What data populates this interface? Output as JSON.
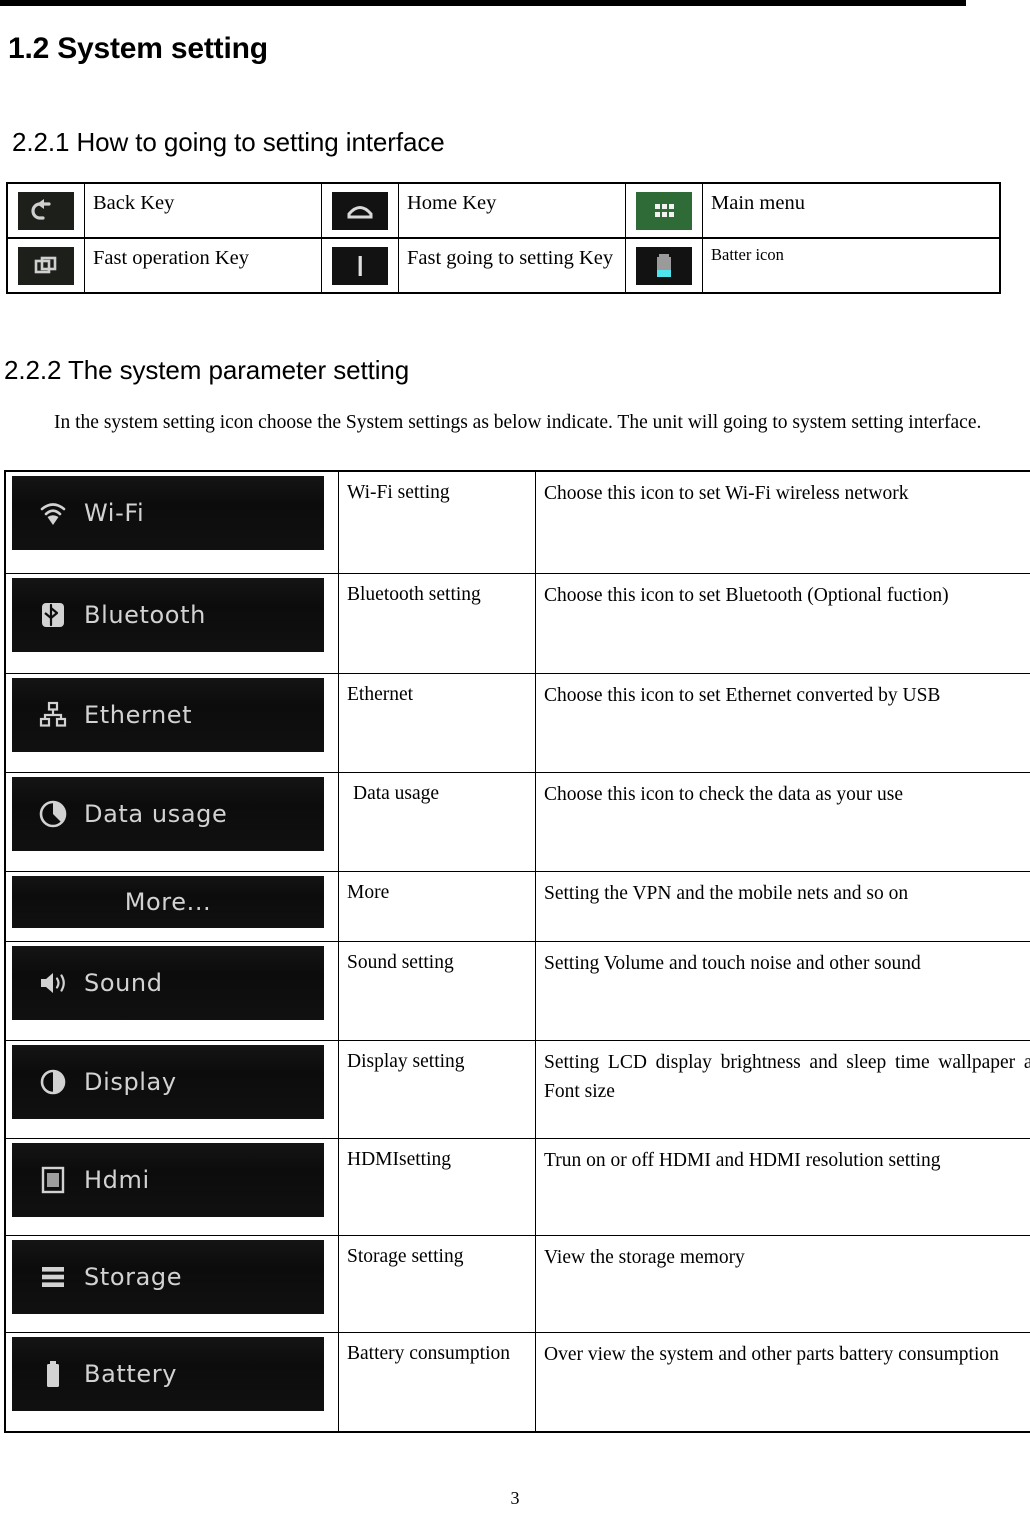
{
  "document": {
    "chapter_heading": "1.2 System setting",
    "section_221_heading": "2.2.1 How to going to setting interface",
    "section_222_heading": "2.2.2 The system parameter setting",
    "intro_paragraph": "In the system setting icon choose the System settings as below indicate. The unit will going to system setting interface.",
    "page_number": "3"
  },
  "nav_table": {
    "rows": [
      {
        "cells": [
          {
            "icon": "back-key-icon",
            "label": "Back Key"
          },
          {
            "icon": "home-key-icon",
            "label": "Home Key"
          },
          {
            "icon": "main-menu-icon",
            "label": "Main menu"
          }
        ]
      },
      {
        "cells": [
          {
            "icon": "fast-operation-key-icon",
            "label": "Fast operation Key"
          },
          {
            "icon": "fast-setting-key-icon",
            "label": "Fast going to setting Key"
          },
          {
            "icon": "battery-icon",
            "label": "Batter icon"
          }
        ]
      }
    ]
  },
  "settings_table": {
    "rows": [
      {
        "image_label": "Wi-Fi",
        "image_icon": "wifi-icon",
        "name": "Wi-Fi setting",
        "description": "Choose this icon to set Wi-Fi wireless network"
      },
      {
        "image_label": "Bluetooth",
        "image_icon": "bluetooth-icon",
        "name": "Bluetooth setting",
        "description": "Choose this icon to set Bluetooth (Optional fuction)"
      },
      {
        "image_label": "Ethernet",
        "image_icon": "ethernet-icon",
        "name": "Ethernet",
        "description": "Choose this icon to set Ethernet converted by USB"
      },
      {
        "image_label": "Data usage",
        "image_icon": "data-usage-icon",
        "name": "Data usage",
        "description": "Choose this icon to check the data as your use"
      },
      {
        "image_label": "More...",
        "image_icon": "none",
        "name": "More",
        "description": "Setting the VPN and the mobile nets and so on"
      },
      {
        "image_label": "Sound",
        "image_icon": "sound-icon",
        "name": "Sound setting",
        "description": "Setting Volume and touch noise and other sound"
      },
      {
        "image_label": "Display",
        "image_icon": "display-icon",
        "name": "Display setting",
        "description": "Setting LCD display brightness and sleep time wallpaper and Font size"
      },
      {
        "image_label": "Hdmi",
        "image_icon": "hdmi-icon",
        "name": "HDMIsetting",
        "description": "Trun on or off HDMI and    HDMI resolution setting"
      },
      {
        "image_label": "Storage",
        "image_icon": "storage-icon",
        "name": "Storage setting",
        "description": "View the storage memory"
      },
      {
        "image_label": "Battery",
        "image_icon": "battery-list-icon",
        "name": "Battery consumption",
        "description": "Over view the system and other parts battery consumption"
      }
    ]
  },
  "colors": {
    "menu_panel_bg": "#0c0c0c",
    "menu_text": "#d2d2d2",
    "main_menu_chip": "#2f6b37",
    "battery_fill": "#4fe3ee",
    "rule": "#000000"
  }
}
